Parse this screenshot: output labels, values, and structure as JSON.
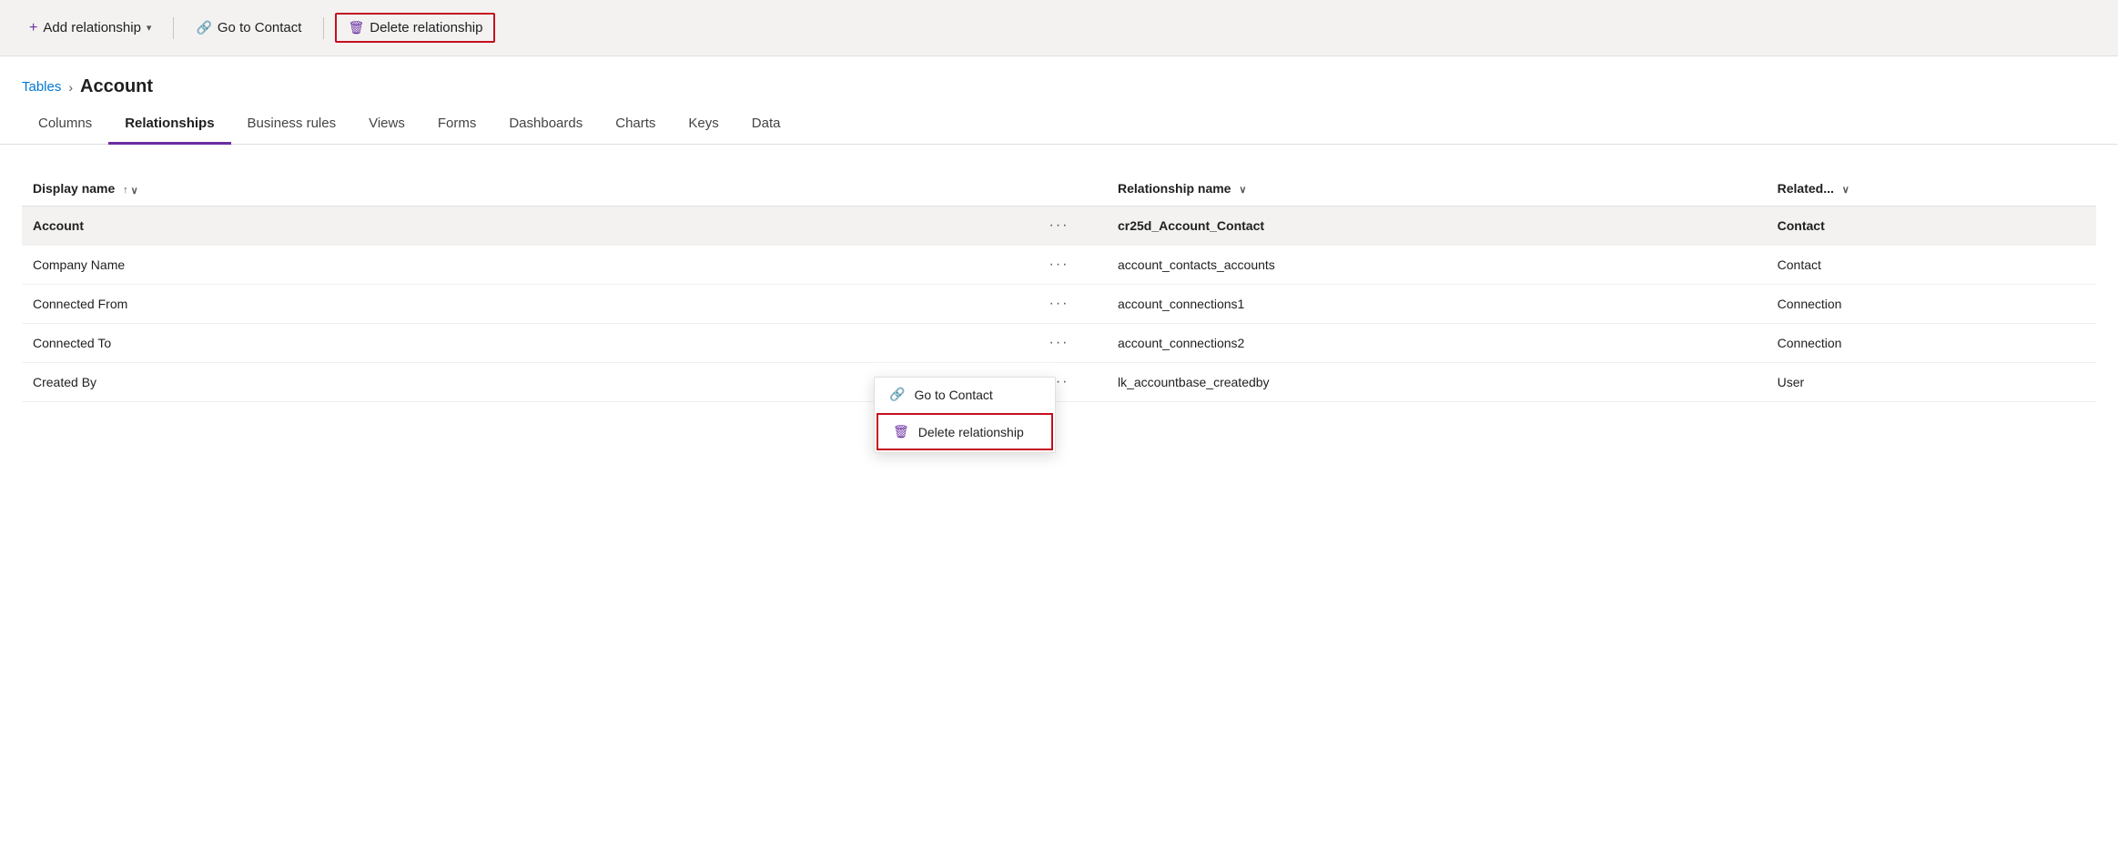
{
  "toolbar": {
    "add_relationship_label": "Add relationship",
    "add_chevron_label": "▾",
    "go_to_contact_label": "Go to Contact",
    "delete_relationship_label": "Delete relationship"
  },
  "breadcrumb": {
    "tables_label": "Tables",
    "separator": "›",
    "current_label": "Account"
  },
  "tabs": [
    {
      "id": "columns",
      "label": "Columns",
      "active": false
    },
    {
      "id": "relationships",
      "label": "Relationships",
      "active": true
    },
    {
      "id": "business-rules",
      "label": "Business rules",
      "active": false
    },
    {
      "id": "views",
      "label": "Views",
      "active": false
    },
    {
      "id": "forms",
      "label": "Forms",
      "active": false
    },
    {
      "id": "dashboards",
      "label": "Dashboards",
      "active": false
    },
    {
      "id": "charts",
      "label": "Charts",
      "active": false
    },
    {
      "id": "keys",
      "label": "Keys",
      "active": false
    },
    {
      "id": "data",
      "label": "Data",
      "active": false
    }
  ],
  "table": {
    "col_display_name": "Display name",
    "col_relationship_name": "Relationship name",
    "col_related": "Related...",
    "rows": [
      {
        "display_name": "Account",
        "selected": true,
        "dots": "···",
        "rel_name": "cr25d_Account_Contact",
        "related": "Contact"
      },
      {
        "display_name": "Company Name",
        "selected": false,
        "dots": "···",
        "rel_name": "account_contacts_accounts",
        "related": "Contact"
      },
      {
        "display_name": "Connected From",
        "selected": false,
        "dots": "···",
        "rel_name": "account_connections1",
        "related": "Connection"
      },
      {
        "display_name": "Connected To",
        "selected": false,
        "dots": "···",
        "rel_name": "account_connections2",
        "related": "Connection"
      },
      {
        "display_name": "Created By",
        "selected": false,
        "dots": "···",
        "rel_name": "lk_accountbase_createdby",
        "related": "User"
      }
    ]
  },
  "context_menu": {
    "go_to_contact_label": "Go to Contact",
    "delete_relationship_label": "Delete relationship"
  },
  "icons": {
    "plus": "+",
    "link": "🔗",
    "trash": "🗑",
    "sort_asc": "↑",
    "sort_desc": "↓",
    "chevron_down": "∨"
  }
}
